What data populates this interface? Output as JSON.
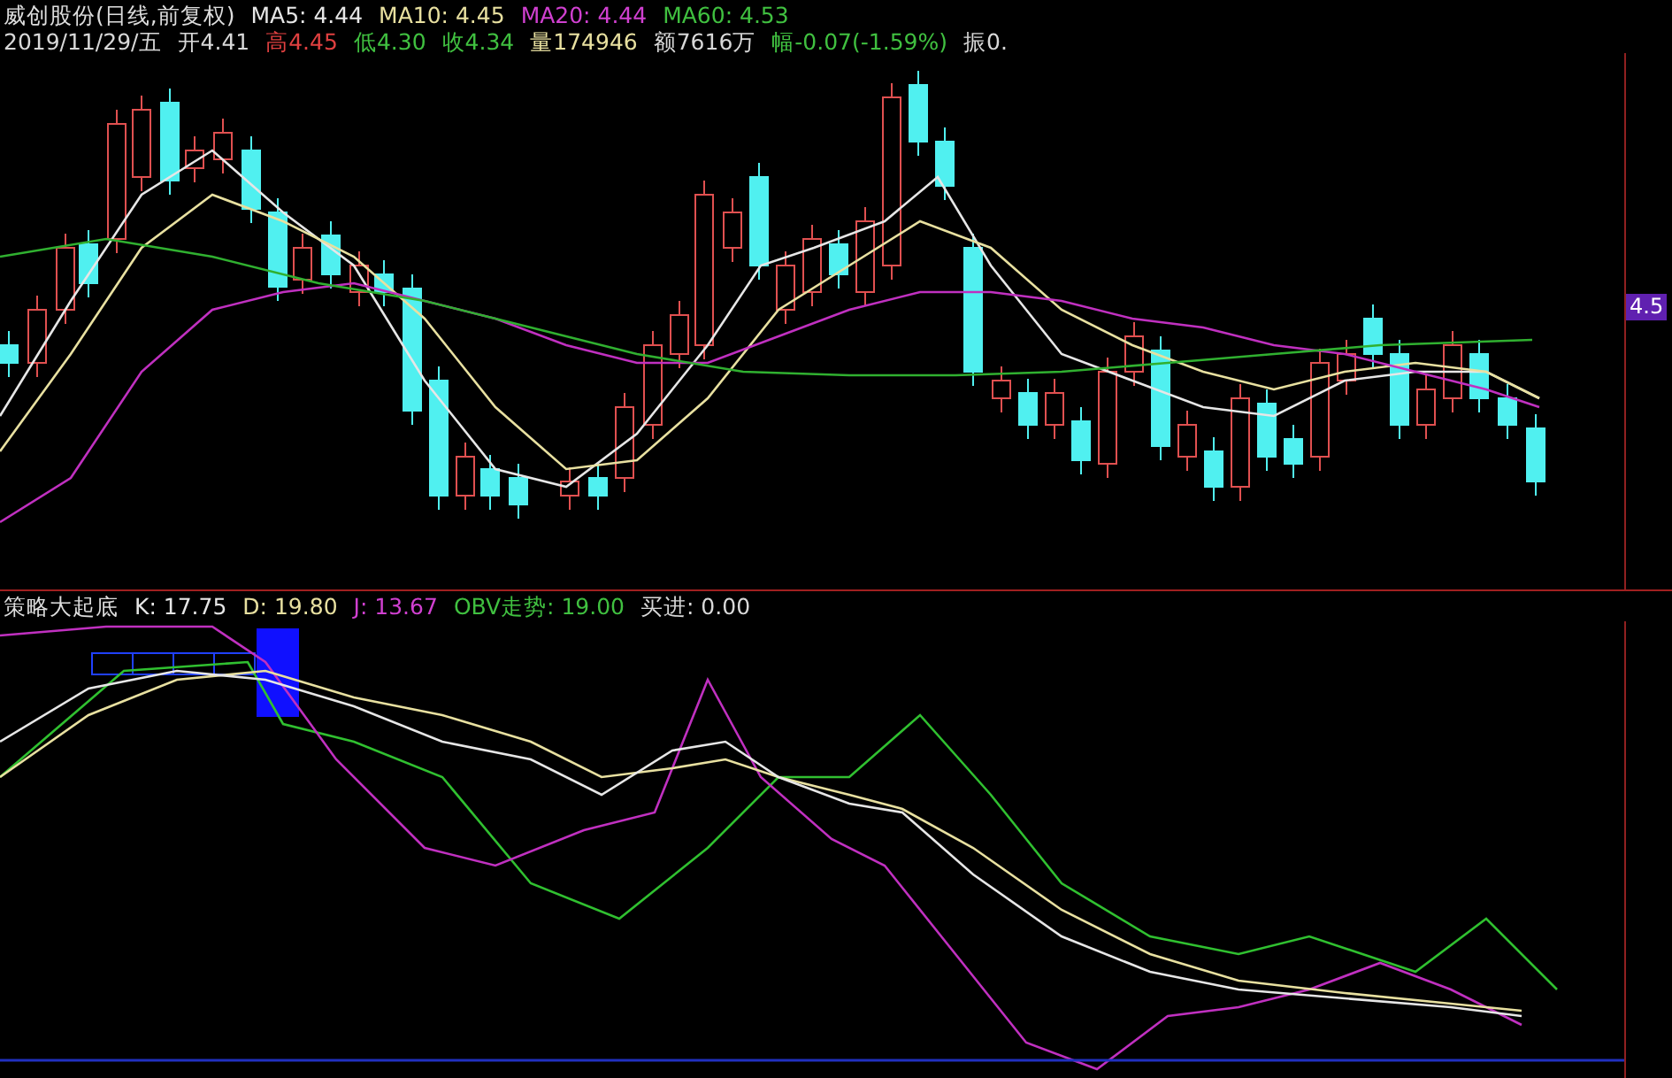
{
  "price_header": {
    "title": "威创股份(日线,前复权)",
    "averages": [
      {
        "label": "MA5: 4.44",
        "color": "#e6e6e6"
      },
      {
        "label": "MA10: 4.45",
        "color": "#e8e0a0"
      },
      {
        "label": "MA20: 4.44",
        "color": "#d040d0"
      },
      {
        "label": "MA60: 4.53",
        "color": "#40c040"
      }
    ]
  },
  "quote": [
    {
      "text": "2019/11/29/五",
      "color": "#d8d8d8"
    },
    {
      "text": "开4.41",
      "color": "#d8d8d8"
    },
    {
      "text": "高4.45",
      "color": "#e04040"
    },
    {
      "text": "低4.30",
      "color": "#40c040"
    },
    {
      "text": "收4.34",
      "color": "#40c040"
    },
    {
      "text": "量174946",
      "color": "#e8e0a0"
    },
    {
      "text": "额7616万",
      "color": "#d8d8d8"
    },
    {
      "text": "幅-0.07(-1.59%)",
      "color": "#40c040"
    },
    {
      "text": "振0.",
      "color": "#d8d8d8"
    }
  ],
  "price_axis": {
    "label": "4.5"
  },
  "indicator_header": {
    "title": "策略大起底",
    "values": [
      {
        "label": "K: 17.75",
        "color": "#e6e6e6"
      },
      {
        "label": "D: 19.80",
        "color": "#e8e0a0"
      },
      {
        "label": "J: 13.67",
        "color": "#d040d0"
      },
      {
        "label": "OBV走势: 19.00",
        "color": "#40c040"
      },
      {
        "label": "买进: 0.00",
        "color": "#d8d8d8"
      }
    ]
  }
}
